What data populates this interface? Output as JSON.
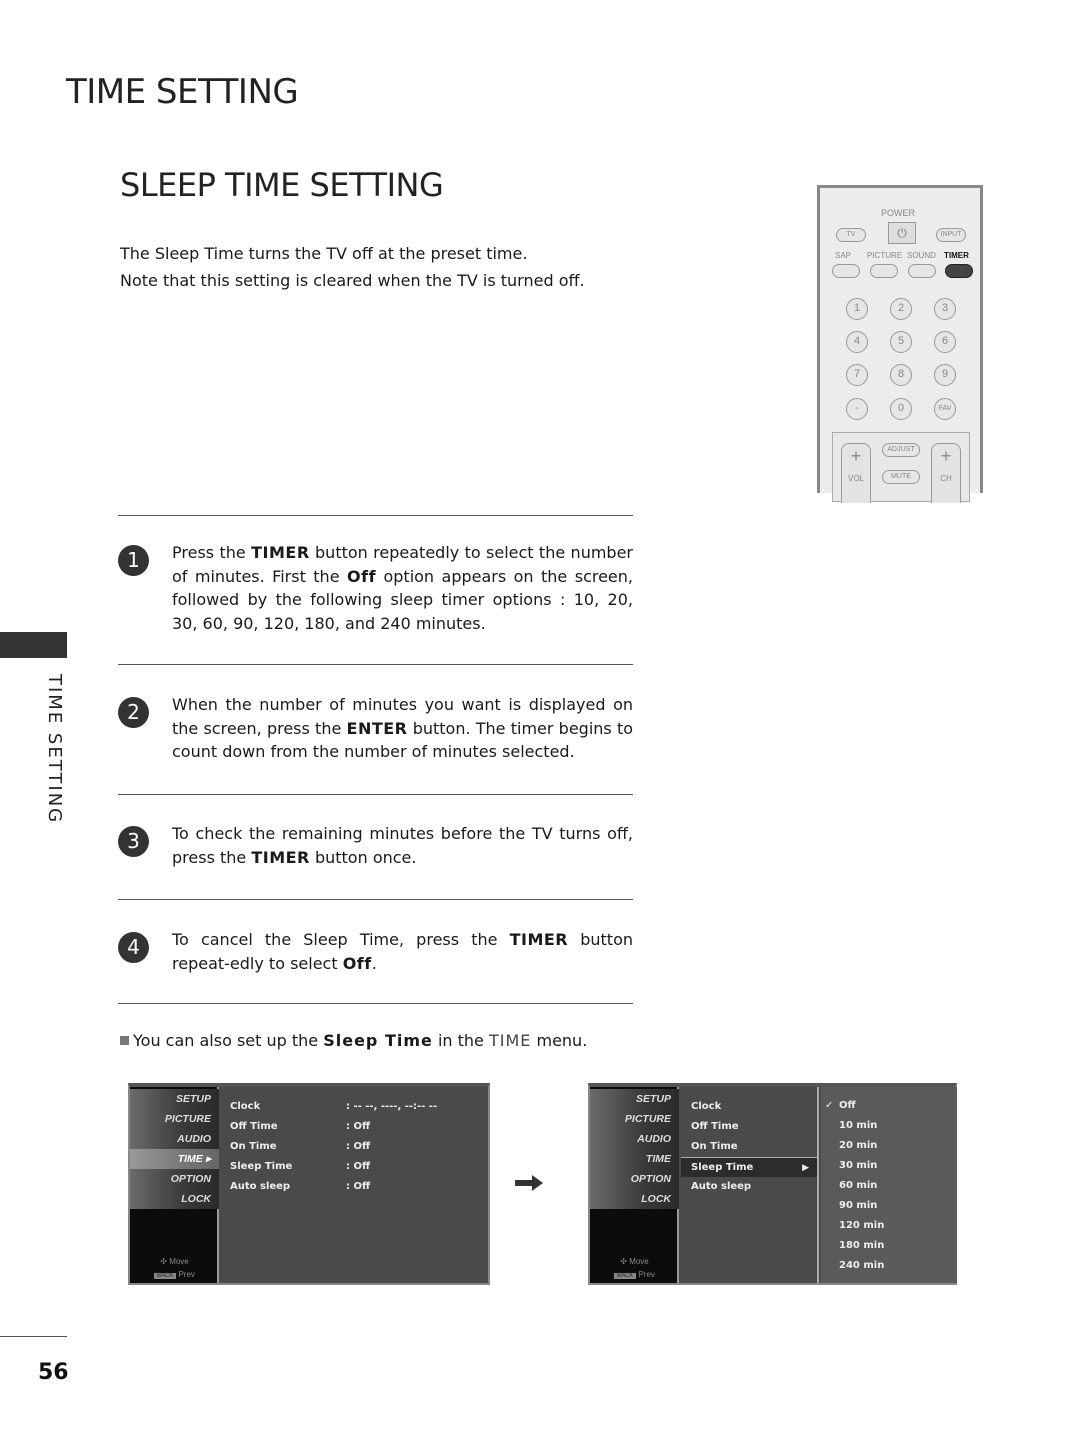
{
  "page": {
    "title": "TIME SETTING",
    "section_title": "SLEEP TIME SETTING",
    "intro": [
      "The Sleep Time turns the TV off at the preset time.",
      "Note that this setting is cleared when the TV is turned off."
    ],
    "side_label": "TIME SETTING",
    "page_number": "56"
  },
  "steps": [
    {
      "number": "1",
      "parts": [
        "Press the ",
        "TIMER",
        " button repeatedly to select the number of minutes. First the ",
        "Off",
        " option appears on the screen, followed by the following sleep timer options : 10, 20, 30, 60, 90, 120, 180, and 240 minutes."
      ]
    },
    {
      "number": "2",
      "parts": [
        "When the number of minutes you want is displayed on the screen, press the ",
        "ENTER",
        " button. The timer begins to count down from the number of minutes selected."
      ]
    },
    {
      "number": "3",
      "parts": [
        "To check the remaining minutes before the TV turns off, press the ",
        "TIMER",
        " button once."
      ]
    },
    {
      "number": "4",
      "parts": [
        "To cancel the Sleep Time, press the ",
        "TIMER",
        " button repeat-edly to select ",
        "Off",
        "."
      ]
    }
  ],
  "note": {
    "parts": [
      "You can also set up the ",
      "Sleep Time",
      " in the ",
      "TIME",
      " menu."
    ]
  },
  "remote": {
    "power_label": "POWER",
    "tv": "TV",
    "input": "INPUT",
    "row_labels": [
      "SAP",
      "PICTURE",
      "SOUND",
      "TIMER"
    ],
    "digits": [
      "1",
      "2",
      "3",
      "4",
      "5",
      "6",
      "7",
      "8",
      "9",
      "-",
      "0",
      "FAV"
    ],
    "adjust": "ADJUST",
    "mute": "MUTE",
    "vol": "VOL",
    "ch": "CH",
    "plus": "+"
  },
  "osd_nav": {
    "items": [
      "SETUP",
      "PICTURE",
      "AUDIO",
      "TIME",
      "OPTION",
      "LOCK"
    ],
    "active": "TIME",
    "hint_move": "Move",
    "hint_back_key": "BACK",
    "hint_prev": "Prev"
  },
  "osd1": {
    "rows": [
      {
        "label": "Clock",
        "value": ": -- --, ----, --:-- --"
      },
      {
        "label": "Off Time",
        "value": ": Off"
      },
      {
        "label": "On Time",
        "value": ": Off"
      },
      {
        "label": "Sleep Time",
        "value": ": Off"
      },
      {
        "label": "Auto sleep",
        "value": ": Off"
      }
    ]
  },
  "osd2": {
    "rows": [
      "Clock",
      "Off Time",
      "On Time",
      "Sleep Time",
      "Auto sleep"
    ],
    "selected": "Sleep Time",
    "submenu": [
      "Off",
      "10 min",
      "20 min",
      "30 min",
      "60 min",
      "90 min",
      "120 min",
      "180 min",
      "240 min"
    ],
    "checked": "Off"
  }
}
